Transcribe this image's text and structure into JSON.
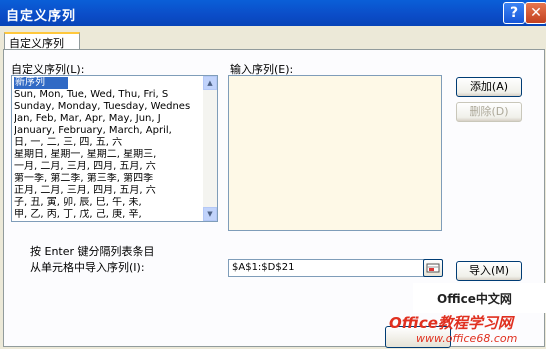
{
  "window": {
    "title": "自定义序列",
    "help_glyph": "?",
    "close_glyph": "✕"
  },
  "tab": {
    "label": "自定义序列"
  },
  "labels": {
    "custom_lists": "自定义序列(L):",
    "input_list": "输入序列(E):",
    "hint": "按 Enter 键分隔列表条目",
    "import_from_cells": "从单元格中导入序列(I):"
  },
  "list_items": [
    "新序列",
    "Sun, Mon, Tue, Wed, Thu, Fri, S",
    "Sunday, Monday, Tuesday, Wednes",
    "Jan, Feb, Mar, Apr, May, Jun, J",
    "January, February, March, April,",
    "日, 一, 二, 三, 四, 五, 六",
    "星期日, 星期一, 星期二, 星期三,",
    "一月, 二月, 三月, 四月, 五月, 六",
    "第一季, 第二季, 第三季, 第四季",
    "正月, 二月, 三月, 四月, 五月, 六",
    "子, 丑, 寅, 卯, 辰, 巳, 午, 未,",
    "甲, 乙, 丙, 丁, 戊, 己, 庚, 辛,"
  ],
  "buttons": {
    "add": "添加(A)",
    "delete": "删除(D)",
    "import": "导入(M)"
  },
  "reference": {
    "value": "$A$1:$D$21"
  },
  "watermark": {
    "office": "Office中文网",
    "main": "Office教程学习网",
    "url": "www.office68.com"
  }
}
